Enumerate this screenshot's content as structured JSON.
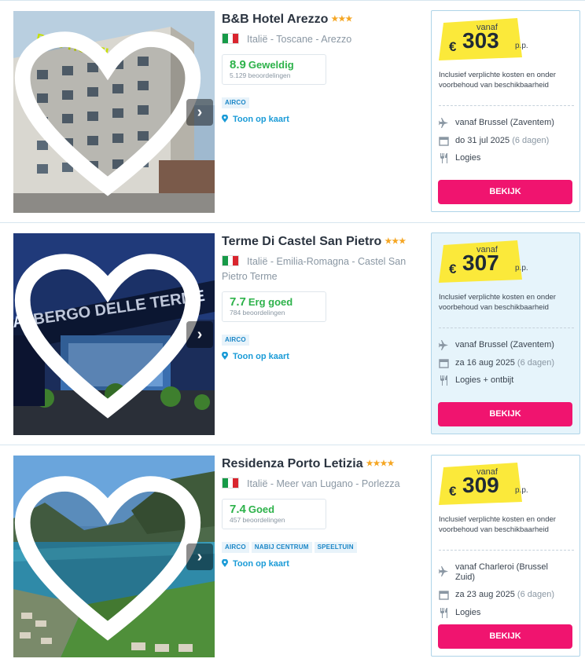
{
  "hotels": [
    {
      "name": "B&B Hotel Arezzo",
      "stars": "★★★",
      "location": "Italië - Toscane - Arezzo",
      "score": "8.9",
      "score_label": "Geweldig",
      "reviews": "5.129 beoordelingen",
      "tags": [
        "AIRCO"
      ],
      "map_link": "Toon op kaart",
      "price": {
        "vanaf": "vanaf",
        "currency": "€",
        "amount": "303",
        "pp": "p.p.",
        "incl": "Inclusief verplichte kosten en onder voorbehoud van beschikbaarheid",
        "departure": "vanaf Brussel (Zaventem)",
        "date": "do 31 jul 2025",
        "duration": "(6 dagen)",
        "board": "Logies",
        "button": "BEKIJK"
      }
    },
    {
      "name": "Terme Di Castel San Pietro",
      "stars": "★★★",
      "location": "Italië - Emilia-Romagna - Castel San Pietro Terme",
      "score": "7.7",
      "score_label": "Erg goed",
      "reviews": "784 beoordelingen",
      "tags": [
        "AIRCO"
      ],
      "map_link": "Toon op kaart",
      "price": {
        "vanaf": "vanaf",
        "currency": "€",
        "amount": "307",
        "pp": "p.p.",
        "incl": "Inclusief verplichte kosten en onder voorbehoud van beschikbaarheid",
        "departure": "vanaf Brussel (Zaventem)",
        "date": "za 16 aug 2025",
        "duration": "(6 dagen)",
        "board": "Logies + ontbijt",
        "button": "BEKIJK"
      }
    },
    {
      "name": "Residenza Porto Letizia",
      "stars": "★★★★",
      "location": "Italië - Meer van Lugano - Porlezza",
      "score": "7.4",
      "score_label": "Goed",
      "reviews": "457 beoordelingen",
      "tags": [
        "AIRCO",
        "NABIJ CENTRUM",
        "SPEELTUIN"
      ],
      "map_link": "Toon op kaart",
      "price": {
        "vanaf": "vanaf",
        "currency": "€",
        "amount": "309",
        "pp": "p.p.",
        "incl": "Inclusief verplichte kosten en onder voorbehoud van beschikbaarheid",
        "departure": "vanaf Charleroi (Brussel Zuid)",
        "date": "za 23 aug 2025",
        "duration": "(6 dagen)",
        "board": "Logies",
        "button": "BEKIJK"
      }
    }
  ],
  "photo_texts": [
    "B&B HOTELS",
    "ALBERGO DELLE TERME"
  ],
  "colors": {
    "accent": "#f0146f",
    "link": "#1a9bd7",
    "score_green": "#2db24a",
    "star": "#f5a623",
    "price_badge": "#fbe93a"
  },
  "icons": {
    "favorite": "heart-outline-icon",
    "next": "chevron-right-icon",
    "map": "map-pin-icon",
    "flight": "airplane-icon",
    "date": "calendar-icon",
    "board": "cutlery-icon"
  }
}
